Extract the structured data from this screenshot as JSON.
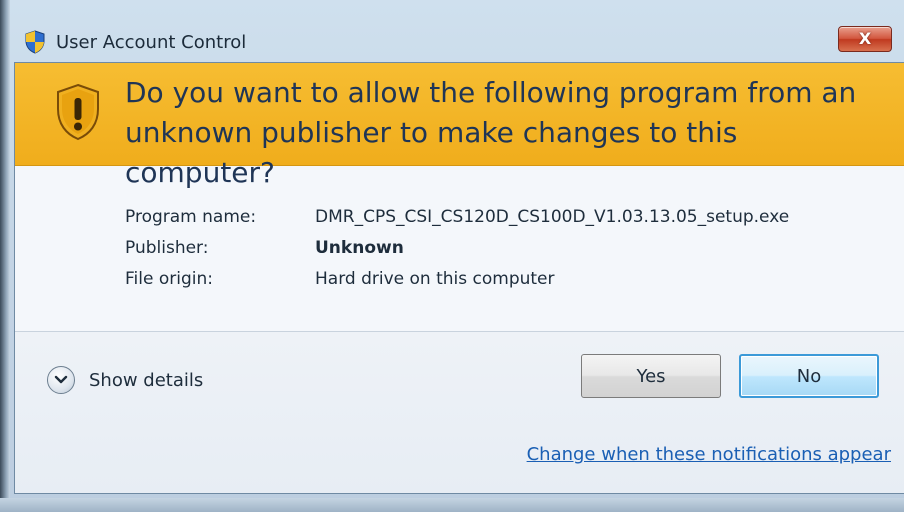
{
  "window": {
    "title": "User Account Control",
    "close_label": "X"
  },
  "banner": {
    "question": "Do you want to allow the following program from an unknown publisher to make changes to this computer?"
  },
  "details": {
    "program_name_label": "Program name:",
    "program_name_value": "DMR_CPS_CSI_CS120D_CS100D_V1.03.13.05_setup.exe",
    "publisher_label": "Publisher:",
    "publisher_value": "Unknown",
    "file_origin_label": "File origin:",
    "file_origin_value": "Hard drive on this computer"
  },
  "footer": {
    "show_details_label": "Show details",
    "yes_label": "Yes",
    "no_label": "No",
    "link_text": "Change when these notifications appear"
  },
  "icons": {
    "title_icon": "uac-shield-icon",
    "banner_icon": "warning-shield-icon",
    "details_toggle_icon": "chevron-down-icon"
  },
  "colors": {
    "banner": "#f6bd32",
    "link": "#1a5fb4",
    "close_button": "#d2563e",
    "default_button_border": "#3c9ad8"
  }
}
